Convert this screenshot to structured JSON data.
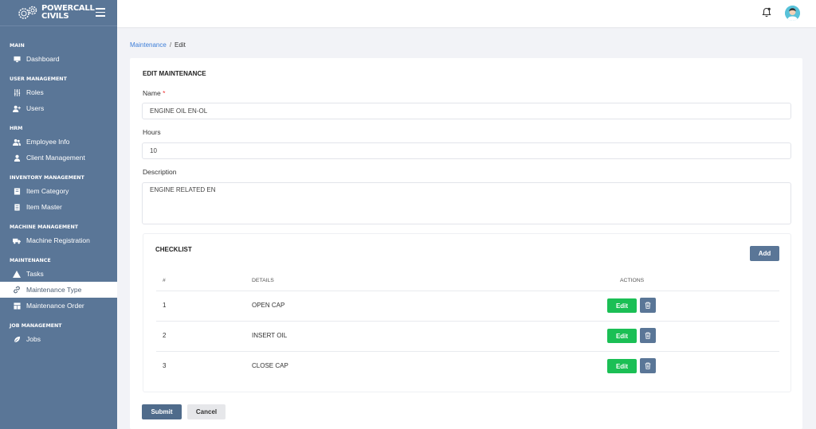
{
  "brand": {
    "line1": "POWERCALL",
    "line2": "CIVILS"
  },
  "sidebar": {
    "sections": [
      {
        "title": "MAIN",
        "items": [
          {
            "label": "Dashboard",
            "icon": "monitor-icon"
          }
        ]
      },
      {
        "title": "USER MANAGEMENT",
        "items": [
          {
            "label": "Roles",
            "icon": "sliders-icon"
          },
          {
            "label": "Users",
            "icon": "user-plus-icon"
          }
        ]
      },
      {
        "title": "HRM",
        "items": [
          {
            "label": "Employee Info",
            "icon": "users-icon"
          },
          {
            "label": "Client Management",
            "icon": "user-icon"
          }
        ]
      },
      {
        "title": "INVENTORY MANAGEMENT",
        "items": [
          {
            "label": "Item Category",
            "icon": "book-icon"
          },
          {
            "label": "Item Master",
            "icon": "notebook-icon"
          }
        ]
      },
      {
        "title": "MACHINE MANAGEMENT",
        "items": [
          {
            "label": "Machine Registration",
            "icon": "truck-icon"
          }
        ]
      },
      {
        "title": "MAINTENANCE",
        "items": [
          {
            "label": "Tasks",
            "icon": "warning-icon"
          },
          {
            "label": "Maintenance Type",
            "icon": "link-icon",
            "active": true
          },
          {
            "label": "Maintenance Order",
            "icon": "table-icon"
          }
        ]
      },
      {
        "title": "JOB MANAGEMENT",
        "items": [
          {
            "label": "Jobs",
            "icon": "leaf-icon"
          }
        ]
      }
    ]
  },
  "breadcrumb": {
    "parent": "Maintenance",
    "separator": "/",
    "current": "Edit"
  },
  "form": {
    "title": "EDIT MAINTENANCE",
    "name_label": "Name",
    "required_mark": "*",
    "name_value": "ENGINE OIL EN-OL",
    "hours_label": "Hours",
    "hours_value": "10",
    "description_label": "Description",
    "description_value": "ENGINE RELATED EN"
  },
  "checklist": {
    "title": "CHECKLIST",
    "add_label": "Add",
    "headers": {
      "no": "#",
      "details": "DETAILS",
      "actions": "ACTIONS"
    },
    "edit_label": "Edit",
    "rows": [
      {
        "no": "1",
        "details": "OPEN CAP"
      },
      {
        "no": "2",
        "details": "INSERT OIL"
      },
      {
        "no": "3",
        "details": "CLOSE CAP"
      }
    ]
  },
  "actions": {
    "submit_label": "Submit",
    "cancel_label": "Cancel"
  },
  "colors": {
    "sidebar": "#5a7697",
    "link": "#3d7ed8",
    "edit": "#1bbf55",
    "required": "#ee3333"
  }
}
